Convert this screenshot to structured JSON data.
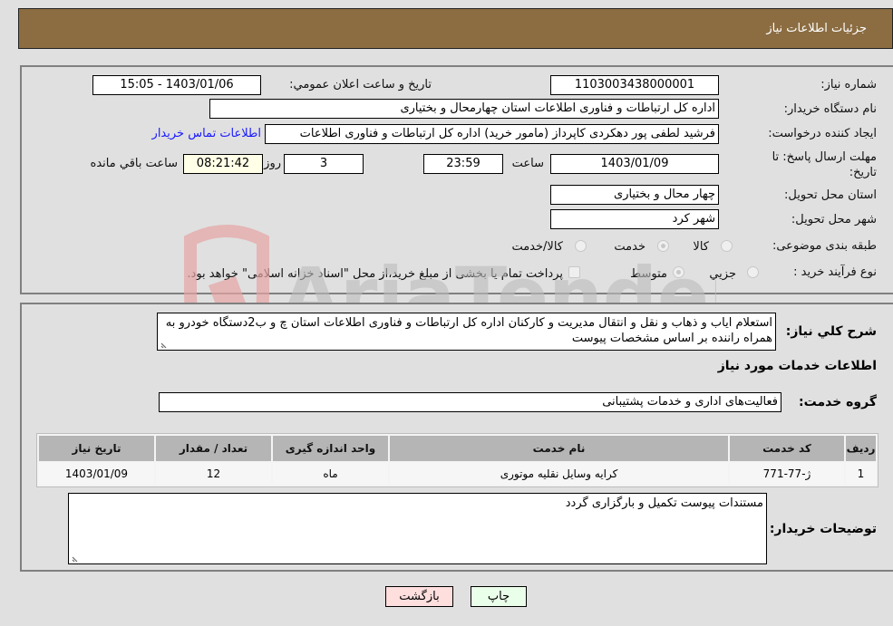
{
  "header": {
    "title": "جزئیات اطلاعات نیاز"
  },
  "form": {
    "need_number": {
      "label": "شماره نیاز:",
      "value": "1103003438000001"
    },
    "announce_datetime": {
      "label": "تاریخ و ساعت اعلان عمومي:",
      "value": "1403/01/06 - 15:05"
    },
    "buyer_org": {
      "label": "نام دستگاه خریدار:",
      "value": "اداره کل ارتباطات و فناوری اطلاعات استان چهارمحال و بختیاری"
    },
    "requester": {
      "label": "ایجاد کننده درخواست:",
      "value": "فرشید لطفی پور دهکردی کاپرداز (مامور خرید) اداره کل ارتباطات و فناوری اطلاعات",
      "contact_link": "اطلاعات تماس خریدار"
    },
    "deadline": {
      "label_line1": "مهلت ارسال پاسخ: تا",
      "label_line2": "تاریخ:",
      "date": "1403/01/09",
      "time_label": "ساعت",
      "time": "23:59",
      "days": "3",
      "days_label": "روز و",
      "remaining": "08:21:42",
      "remaining_label": "ساعت باقي مانده"
    },
    "province": {
      "label": "استان محل تحویل:",
      "value": "چهار محال و بختیاری"
    },
    "city": {
      "label": "شهر محل تحویل:",
      "value": "شهر کرد"
    },
    "category": {
      "label": "طبقه بندی موضوعی:",
      "options": [
        "کالا",
        "خدمت",
        "کالا/خدمت"
      ],
      "selected": "خدمت"
    },
    "process_type": {
      "label": "نوع فرآیند خرید :",
      "options": [
        "جزيي",
        "متوسط"
      ],
      "selected": "متوسط",
      "treasury_note": "پرداخت تمام یا بخشی از مبلغ خرید،از محل \"اسناد خزانه اسلامی\" خواهد بود.",
      "treasury_checked": false
    }
  },
  "description": {
    "label": "شرح کلي نیاز:",
    "value": "استعلام ایاب و ذهاب و نقل و انتقال مدیریت و کارکنان اداره کل ارتباطات و فناوری اطلاعات استان چ و ب2دستگاه خودرو به همراه راننده بر اساس مشخصات پیوست"
  },
  "services_section": {
    "title": "اطلاعات خدمات مورد نیاز",
    "group_label": "گروه خدمت:",
    "group_value": "فعالیت‌های اداری و خدمات پشتیبانی",
    "table": {
      "headers": [
        "ردیف",
        "کد خدمت",
        "نام خدمت",
        "واحد اندازه گیری",
        "تعداد / مقدار",
        "تاریخ نیاز"
      ],
      "rows": [
        [
          "1",
          "ژ-77-771",
          "کرایه وسایل نقلیه موتوری",
          "ماه",
          "12",
          "1403/01/09"
        ]
      ]
    }
  },
  "buyer_notes": {
    "label": "توضیحات خریدار:",
    "value": "مستندات پیوست تکمیل و بارگزاری گردد"
  },
  "buttons": {
    "print": "چاپ",
    "back": "بازگشت"
  },
  "watermark": {
    "text": "AriaTender.neT"
  },
  "colors": {
    "header_bg": "#8c6d42",
    "link": "#1a1aff",
    "print_btn": "#eaffea",
    "back_btn": "#ffdede"
  }
}
